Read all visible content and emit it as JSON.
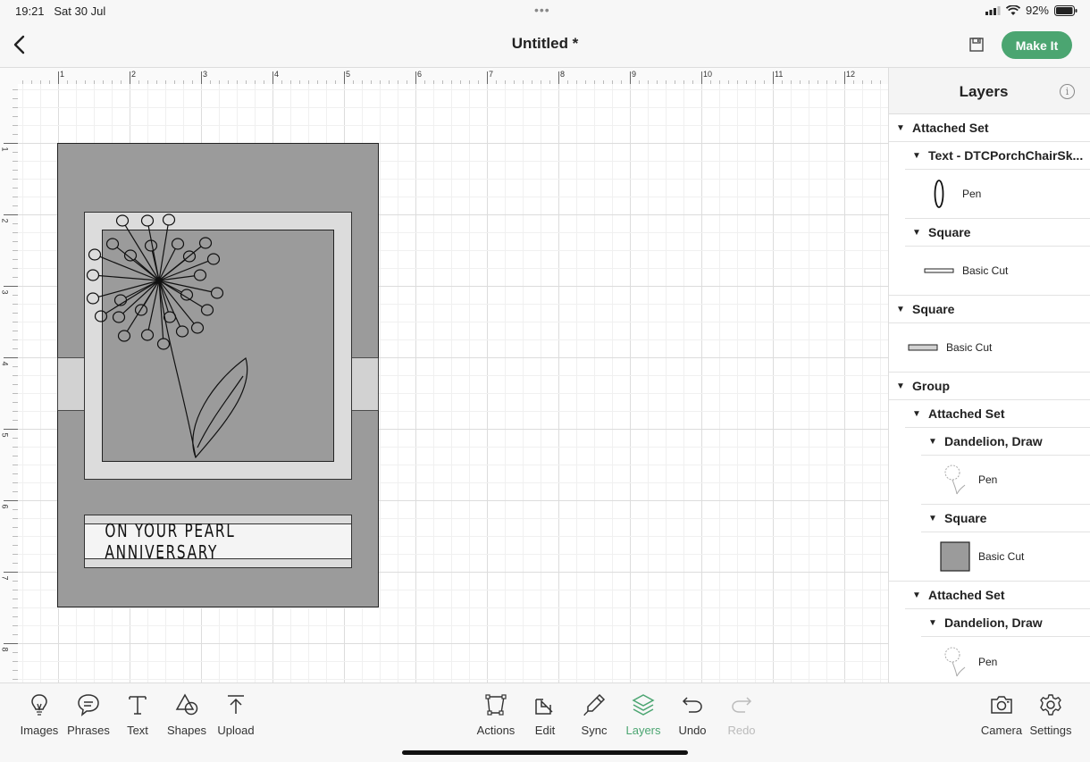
{
  "status": {
    "time": "19:21",
    "date": "Sat 30 Jul",
    "battery": "92%"
  },
  "header": {
    "title": "Untitled *",
    "make_it": "Make It"
  },
  "ruler": {
    "top_labels": [
      "1",
      "2",
      "3",
      "4",
      "5",
      "6",
      "7",
      "8",
      "9",
      "10",
      "11",
      "12"
    ],
    "left_labels": [
      "1",
      "2",
      "3",
      "4",
      "5",
      "6",
      "7",
      "8"
    ]
  },
  "canvas": {
    "banner_text": "ON YOUR PEARL ANNIVERSARY"
  },
  "layers": {
    "title": "Layers",
    "items": [
      {
        "label": "Attached Set"
      },
      {
        "label": "Text - DTCPorchChairSk..."
      },
      {
        "label": "Pen"
      },
      {
        "label": "Square"
      },
      {
        "label": "Basic Cut"
      },
      {
        "label": "Square"
      },
      {
        "label": "Basic Cut"
      },
      {
        "label": "Group"
      },
      {
        "label": "Attached Set"
      },
      {
        "label": "Dandelion, Draw"
      },
      {
        "label": "Pen"
      },
      {
        "label": "Square"
      },
      {
        "label": "Basic Cut"
      },
      {
        "label": "Attached Set"
      },
      {
        "label": "Dandelion, Draw"
      },
      {
        "label": "Pen"
      }
    ]
  },
  "toolbar": {
    "images": "Images",
    "phrases": "Phrases",
    "text": "Text",
    "shapes": "Shapes",
    "upload": "Upload",
    "actions": "Actions",
    "edit": "Edit",
    "sync": "Sync",
    "layers": "Layers",
    "undo": "Undo",
    "redo": "Redo",
    "camera": "Camera",
    "settings": "Settings"
  },
  "colors": {
    "accent": "#4ba571",
    "card": "#9b9b9b",
    "mat": "#dcdcdc"
  }
}
